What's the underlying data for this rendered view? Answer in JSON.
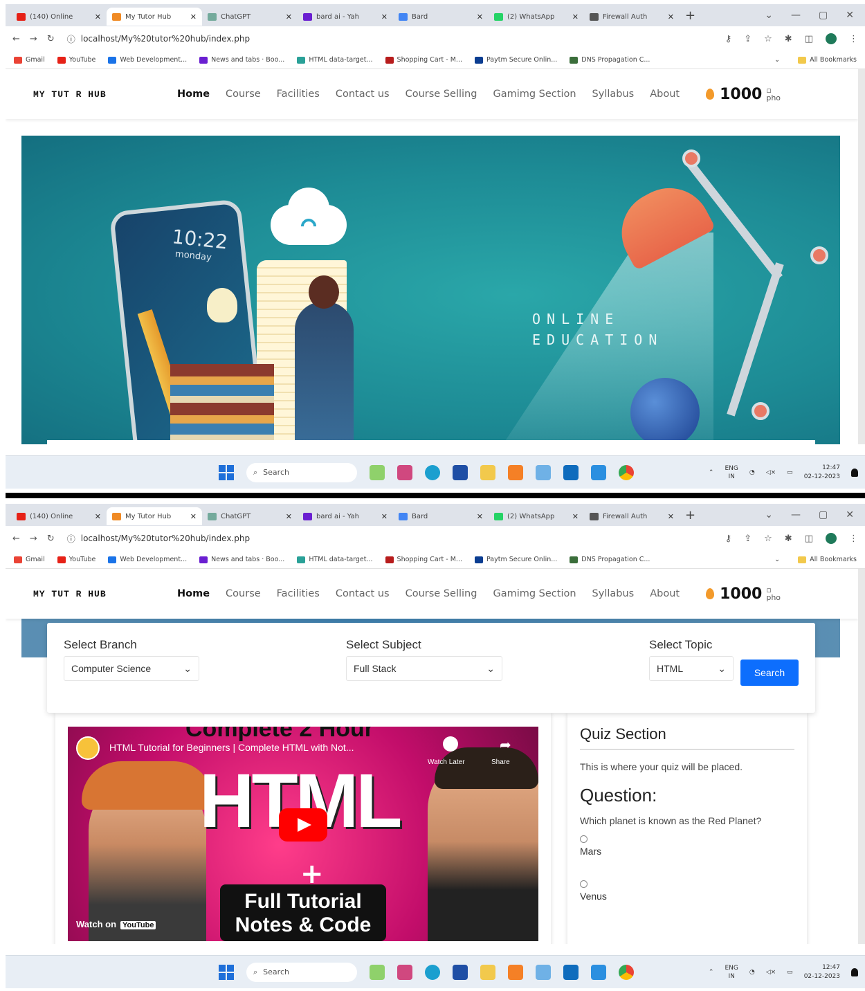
{
  "browser": {
    "tabs": [
      {
        "title": "(140) Online",
        "color": "#e62117"
      },
      {
        "title": "My Tutor Hub",
        "color": "#f08a24",
        "active": true
      },
      {
        "title": "ChatGPT",
        "color": "#74aa9c"
      },
      {
        "title": "bard ai - Yah",
        "color": "#6a1fd1"
      },
      {
        "title": "Bard",
        "color": "#4285f4"
      },
      {
        "title": "(2) WhatsApp",
        "color": "#25d366"
      },
      {
        "title": "Firewall Auth",
        "color": "#555555"
      }
    ],
    "url": "localhost/My%20tutor%20hub/index.php",
    "bookmarks": [
      {
        "label": "Gmail",
        "color": "#ea4335"
      },
      {
        "label": "YouTube",
        "color": "#e62117"
      },
      {
        "label": "Web Development...",
        "color": "#1a73e8"
      },
      {
        "label": "News and tabs · Boo...",
        "color": "#6a1fd1"
      },
      {
        "label": "HTML data-target...",
        "color": "#2aa198"
      },
      {
        "label": "Shopping Cart - M...",
        "color": "#b71c1c"
      },
      {
        "label": "Paytm Secure Onlin...",
        "color": "#0b3d91"
      },
      {
        "label": "DNS Propagation C...",
        "color": "#3b6e3b"
      }
    ],
    "all_bookmarks": "All Bookmarks"
  },
  "site": {
    "logo": "MY TUT R HUB",
    "nav": [
      "Home",
      "Course",
      "Facilities",
      "Contact us",
      "Course Selling",
      "Gamimg Section",
      "Syllabus",
      "About"
    ],
    "coins": "1000",
    "profile_alt": "pho"
  },
  "hero": {
    "time": "10:22",
    "day": "monday",
    "line1": "ONLINE",
    "line2": "EDUCATION"
  },
  "filters": {
    "branch_label": "Select Branch",
    "branch_value": "Computer Science",
    "subject_label": "Select Subject",
    "subject_value": "Full Stack",
    "topic_label": "Select Topic",
    "topic_value": "HTML",
    "search_button": "Search"
  },
  "video": {
    "title": "HTML Tutorial for Beginners | Complete HTML with Not...",
    "top_text": "Complete 2 Hour",
    "big_text": "HTML",
    "plus": "+",
    "box_line1": "Full Tutorial",
    "box_line2": "Notes & Code",
    "watch_on": "Watch on",
    "youtube": "YouTube",
    "watch_later": "Watch Later",
    "share": "Share"
  },
  "quiz": {
    "title": "Quiz Section",
    "description": "This is where your quiz will be placed.",
    "question_heading": "Question:",
    "question_text": "Which planet is known as the Red Planet?",
    "options": [
      "Mars",
      "Venus"
    ]
  },
  "taskbar": {
    "search": "Search",
    "lang1": "ENG",
    "lang2": "IN",
    "time": "12:47",
    "date": "02-12-2023"
  }
}
